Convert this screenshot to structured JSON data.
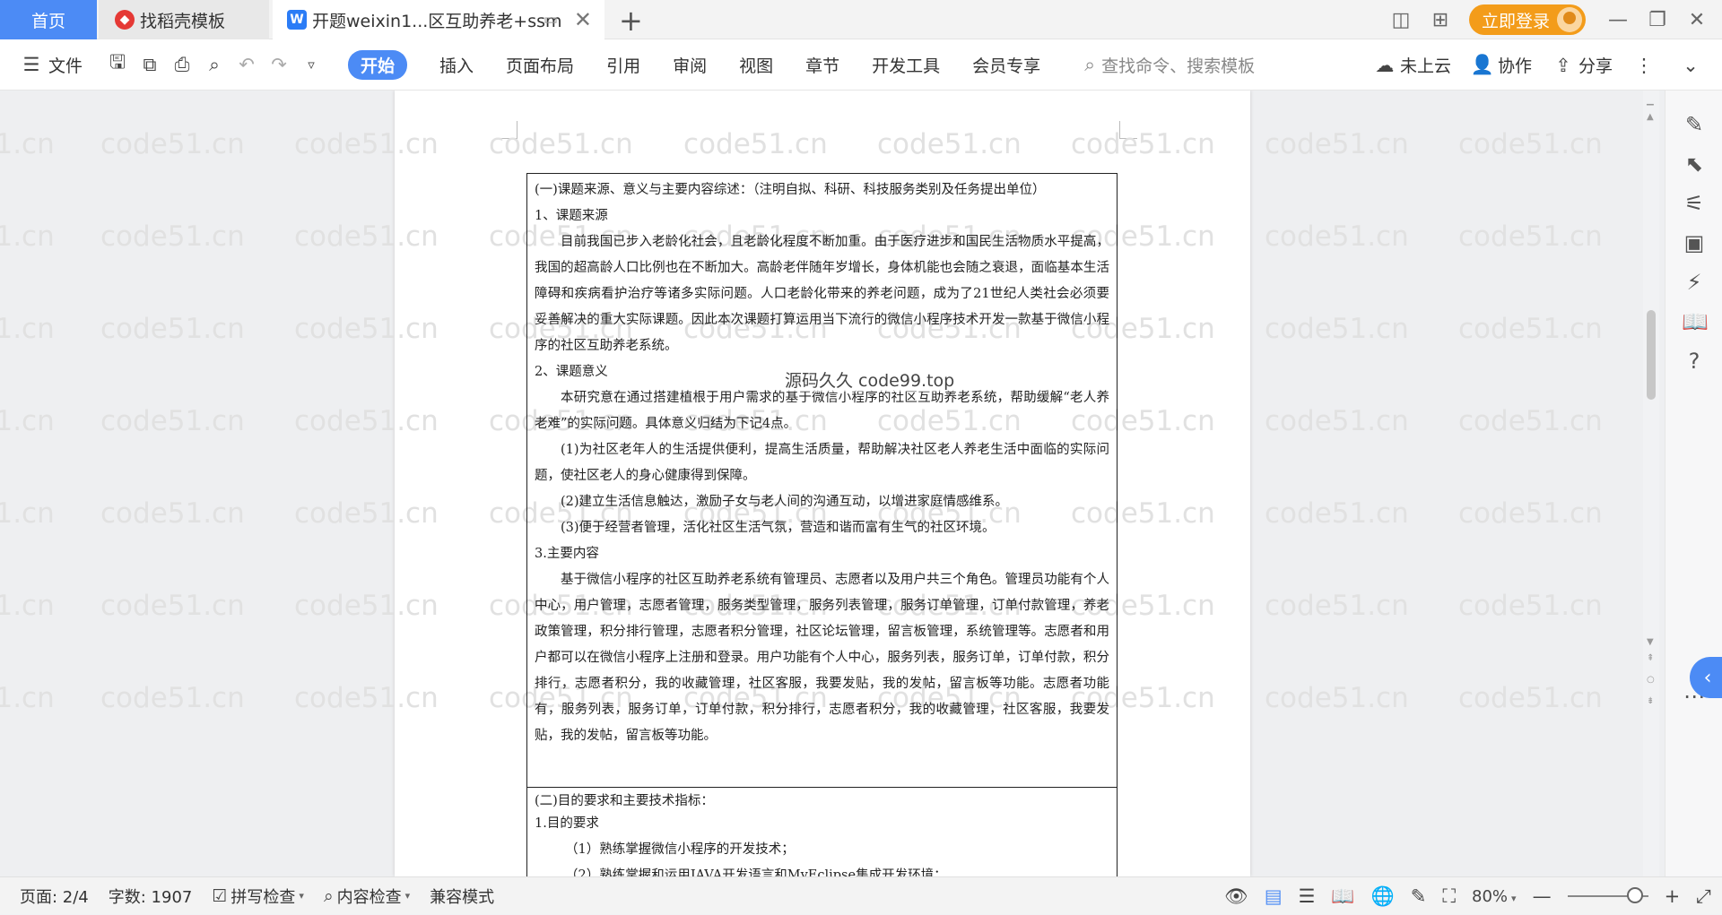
{
  "titlebar": {
    "tabs": [
      {
        "label": "首页"
      },
      {
        "label": "找稻壳模板"
      },
      {
        "label": "开题weixin1...区互助养老+ssm"
      }
    ],
    "login_label": "立即登录"
  },
  "ribbon": {
    "file_label": "文件",
    "tabs": [
      "开始",
      "插入",
      "页面布局",
      "引用",
      "审阅",
      "视图",
      "章节",
      "开发工具",
      "会员专享"
    ],
    "search_placeholder": "查找命令、搜索模板",
    "cloud_label": "未上云",
    "collab_label": "协作",
    "share_label": "分享"
  },
  "watermark": "code51.cn",
  "document": {
    "section1_title": "(一)课题来源、意义与主要内容综述：（注明自拟、科研、科技服务类别及任务提出单位）",
    "h1": "1、课题来源",
    "p1": "目前我国已步入老龄化社会，且老龄化程度不断加重。由于医疗进步和国民生活物质水平提高，我国的超高龄人口比例也在不断加大。高龄老伴随年岁增长，身体机能也会随之衰退，面临基本生活障碍和疾病看护治疗等诸多实际问题。人口老龄化带来的养老问题，成为了21世纪人类社会必须要妥善解决的重大实际课题。因此本次课题打算运用当下流行的微信小程序技术开发一款基于微信小程序的社区互助养老系统。",
    "h2": "2、课题意义",
    "p2": "本研究意在通过搭建植根于用户需求的基于微信小程序的社区互助养老系统，帮助缓解“老人养老难”的实际问题。具体意义归结为下记4点。",
    "l1": "(1)为社区老年人的生活提供便利，提高生活质量，帮助解决社区老人养老生活中面临的实际问题，使社区老人的身心健康得到保障。",
    "l2": "(2)建立生活信息触达，激励子女与老人间的沟通互动，以增进家庭情感维系。",
    "l3": "(3)便于经营者管理，活化社区生活气氛，营造和谐而富有生气的社区环境。",
    "h3": "3.主要内容",
    "p3": "基于微信小程序的社区互助养老系统有管理员、志愿者以及用户共三个角色。管理员功能有个人中心，用户管理，志愿者管理，服务类型管理，服务列表管理，服务订单管理，订单付款管理，养老政策管理，积分排行管理，志愿者积分管理，社区论坛管理，留言板管理，系统管理等。志愿者和用户都可以在微信小程序上注册和登录。用户功能有个人中心，服务列表，服务订单，订单付款，积分排行，志愿者积分，我的收藏管理，社区客服，我要发贴，我的发帖，留言板等功能。志愿者功能有，服务列表，服务订单，订单付款，积分排行，志愿者积分，我的收藏管理，社区客服，我要发贴，我的发帖，留言板等功能。",
    "section2_title": "(二)目的要求和主要技术指标：",
    "s2_h1": "1.目的要求",
    "s2_l1": "（1）熟练掌握微信小程序的开发技术；",
    "s2_l2": "（2）熟练掌握和运用JAVA开发语言和MyEclipse集成开发环境；",
    "overlay": "源码久久 code99.top"
  },
  "statusbar": {
    "page": "页面: 2/4",
    "words": "字数: 1907",
    "spell": "拼写检查",
    "content_check": "内容检查",
    "compat": "兼容模式",
    "zoom": "80%"
  },
  "colors": {
    "accent": "#4c8bf5",
    "login": "#f39c1a"
  }
}
